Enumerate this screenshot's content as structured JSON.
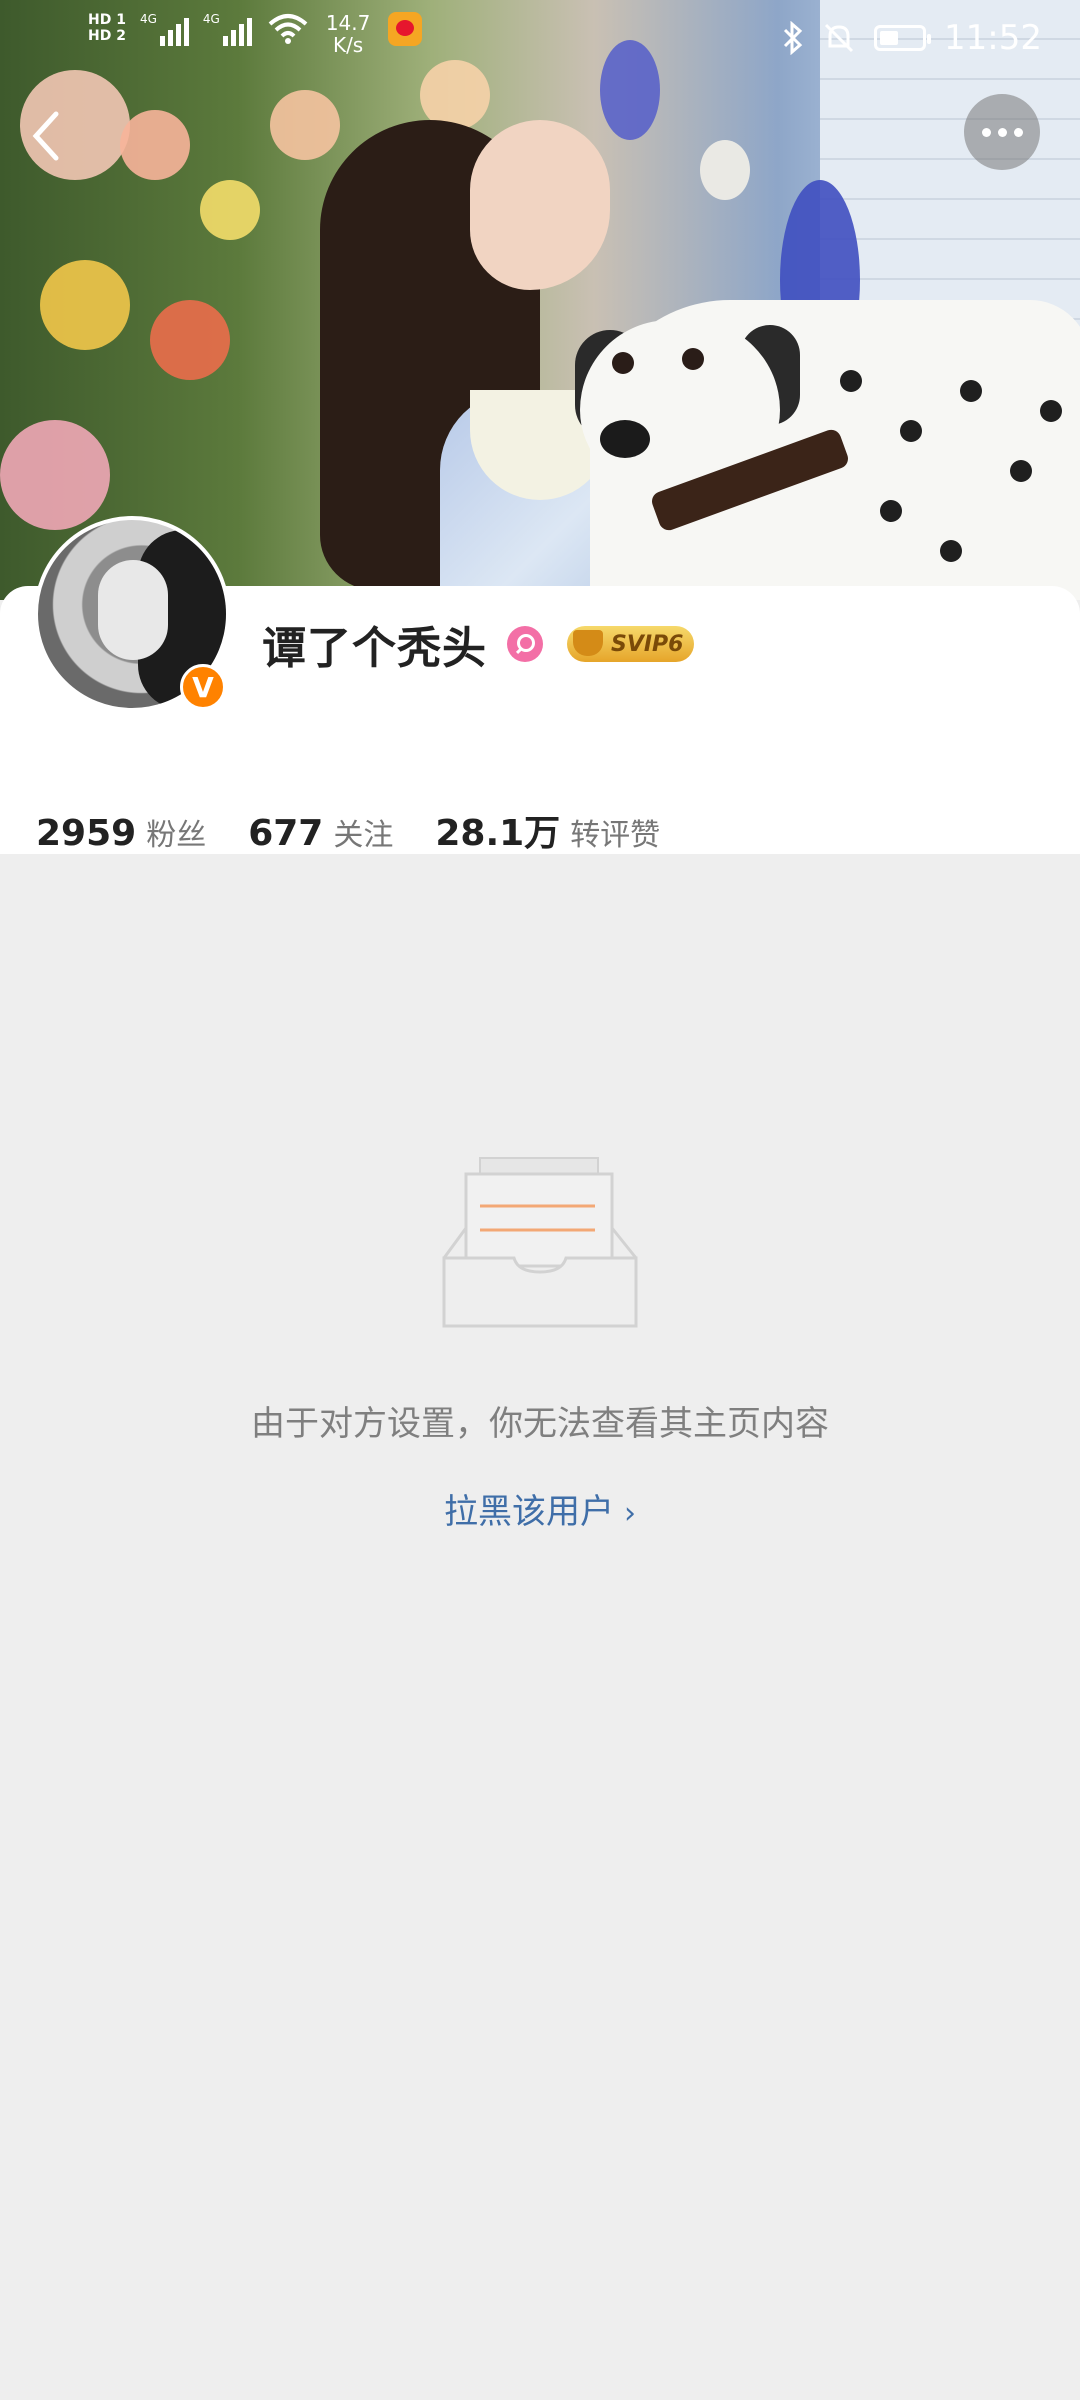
{
  "status_bar": {
    "sim1": "HD 1",
    "sim2": "HD 2",
    "network": "4G",
    "speed_value": "14.7",
    "speed_unit": "K/s",
    "time": "11:52",
    "battery_level": 0.45,
    "icons": [
      "bluetooth-icon",
      "mute-bell-icon",
      "battery-icon",
      "weibo-notification-icon"
    ]
  },
  "profile": {
    "name": "谭了个秃头",
    "verified_badge": "V",
    "vip_label": "SVIP6",
    "stats": [
      {
        "value": "2959",
        "label": "粉丝"
      },
      {
        "value": "677",
        "label": "关注"
      },
      {
        "value": "28.1万",
        "label": "转评赞"
      }
    ]
  },
  "empty_state": {
    "message": "由于对方设置，你无法查看其主页内容",
    "action_label": "拉黑该用户",
    "action_chevron": "›"
  },
  "colors": {
    "background": "#eeeeee",
    "link": "#3f6ea8",
    "verified": "#ff8200",
    "accent_orange": "#f3a875"
  }
}
